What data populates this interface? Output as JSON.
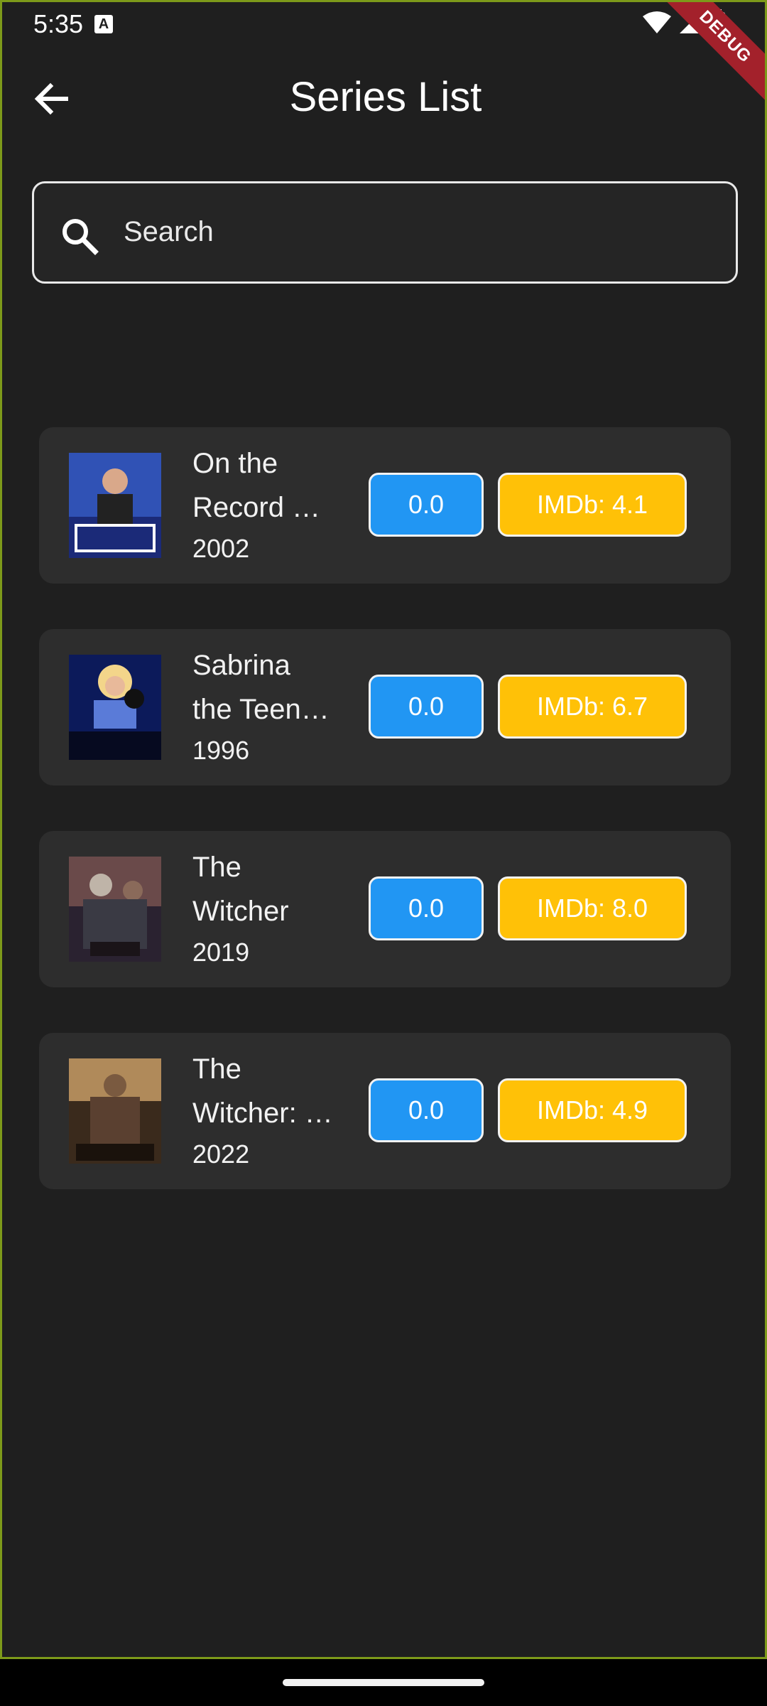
{
  "status_bar": {
    "time": "5:35",
    "badge": "A",
    "debug_label": "DEBUG"
  },
  "app_bar": {
    "title": "Series List",
    "back_icon": "arrow-left-icon"
  },
  "search": {
    "placeholder": "Search",
    "icon": "search-icon"
  },
  "series": [
    {
      "title_line1": "On the",
      "title_line2": "Record …",
      "year": "2002",
      "score": "0.0",
      "imdb": "IMDb: 4.1",
      "poster_colors": [
        "#1b2a78",
        "#7aa4e0"
      ]
    },
    {
      "title_line1": "Sabrina",
      "title_line2": "the Teen…",
      "year": "1996",
      "score": "0.0",
      "imdb": "IMDb: 6.7",
      "poster_colors": [
        "#0c1a5a",
        "#f3d58a"
      ]
    },
    {
      "title_line1": "The",
      "title_line2": "Witcher",
      "year": "2019",
      "score": "0.0",
      "imdb": "IMDb: 8.0",
      "poster_colors": [
        "#2a2230",
        "#8a6a5a"
      ]
    },
    {
      "title_line1": "The",
      "title_line2": "Witcher: …",
      "year": "2022",
      "score": "0.0",
      "imdb": "IMDb: 4.9",
      "poster_colors": [
        "#3a2a1c",
        "#b08a5a"
      ]
    }
  ],
  "colors": {
    "background": "#1f1f1f",
    "card": "#2d2d2d",
    "score_button": "#2196f3",
    "imdb_button": "#ffc107"
  }
}
